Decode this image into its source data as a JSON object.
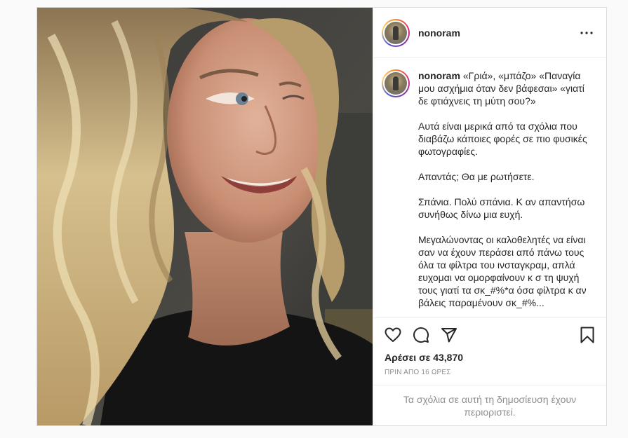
{
  "post": {
    "username": "nonoram",
    "caption": {
      "username": "nonoram",
      "paragraphs": [
        "«Γριά», «μπάζο» «Παναγία μου ασχήμια όταν δεν βάφεσαι» «γιατί δε φτιάχνεις τη μύτη σου?»",
        "Αυτά είναι μερικά από τα σχόλια που διαβάζω κάποιες φορές σε πιο φυσικές φωτογραφίες.",
        "Απαντάς; Θα με ρωτήσετε.",
        "Σπάνια. Πολύ σπάνια. Κ αν απαντήσω συνήθως δίνω μια ευχή.",
        "Μεγαλώνοντας οι καλοθελητές να είναι σαν να έχουν περάσει από πάνω τους όλα τα φίλτρα του ινσταγκραμ, απλά ευχομαι να ομορφαίνουν κ σ τη ψυχή τους γιατί τα σκ_#%*α όσα φίλτρα κ αν βάλεις παραμένουν σκ_#%..."
      ]
    },
    "likes_text": "Αρέσει σε 43,870",
    "time_text": "ΠΡΙΝ ΑΠΟ 16 ΩΡΕΣ",
    "comments_restricted": "Τα σχόλια σε αυτή τη δημοσίευση έχουν περιοριστεί.",
    "icons": {
      "more": "more-options-icon",
      "like": "heart-icon",
      "comment": "comment-icon",
      "share": "paper-plane-icon",
      "save": "bookmark-icon"
    },
    "colors": {
      "text": "#262626",
      "muted": "#8e8e8e",
      "border": "#dbdbdb",
      "background": "#fafafa"
    }
  }
}
